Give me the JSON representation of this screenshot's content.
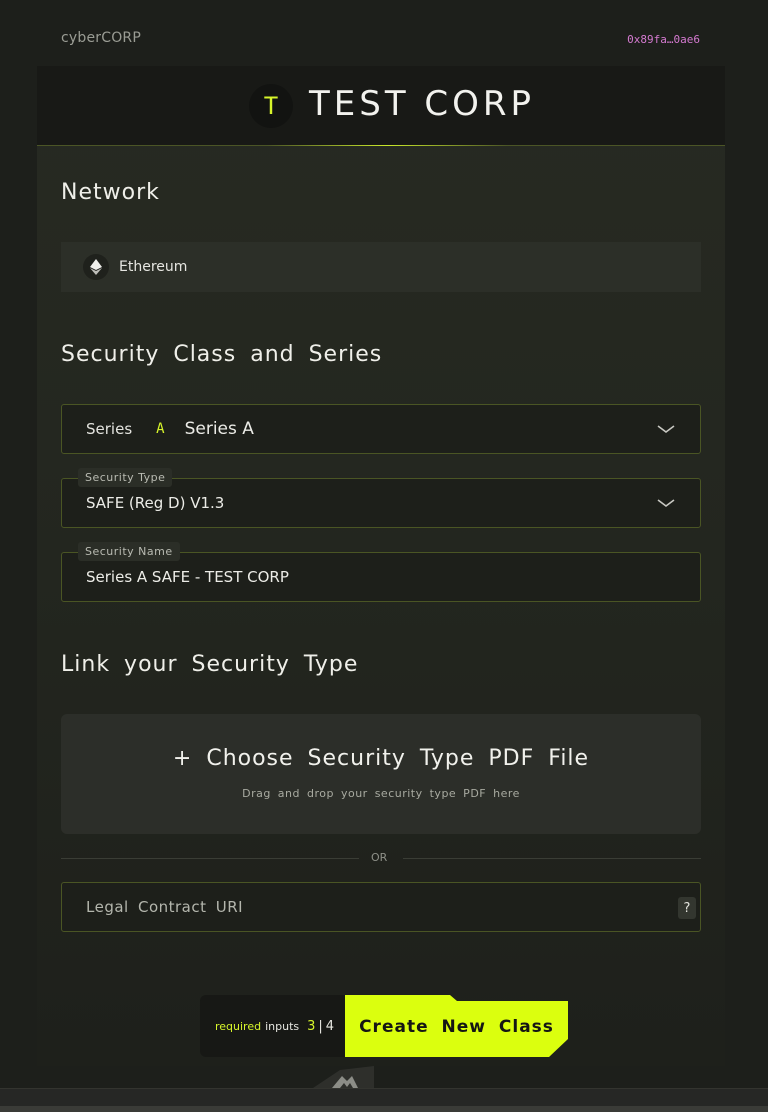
{
  "topbar": {
    "brand": "cyberCORP",
    "wallet": "0x89fa…0ae6"
  },
  "header": {
    "logo_letter": "T",
    "company": "TEST CORP"
  },
  "network": {
    "title": "Network",
    "selected": "Ethereum",
    "icon": "ethereum-icon"
  },
  "security": {
    "title": "Security Class and Series",
    "series": {
      "prefix": "Series",
      "letter": "A",
      "name": "Series A"
    },
    "type": {
      "label": "Security Type",
      "value": "SAFE (Reg D) V1.3"
    },
    "name": {
      "label": "Security Name",
      "value": "Series A SAFE - TEST CORP"
    }
  },
  "link": {
    "title": "Link your Security Type",
    "dropzone_title": "+ Choose Security Type PDF File",
    "dropzone_sub": "Drag and drop your security type PDF here",
    "or": "OR",
    "uri_placeholder": "Legal Contract URI",
    "help": "?"
  },
  "action": {
    "required_word": "required",
    "inputs_word": "inputs",
    "done": "3",
    "separator": "|",
    "total": "4",
    "create_label": "Create New Class"
  },
  "colors": {
    "accent": "#dbff0e",
    "background": "#1d1f1b",
    "panel": "#262922",
    "border": "#4a5524",
    "wallet": "#d47ad0"
  }
}
